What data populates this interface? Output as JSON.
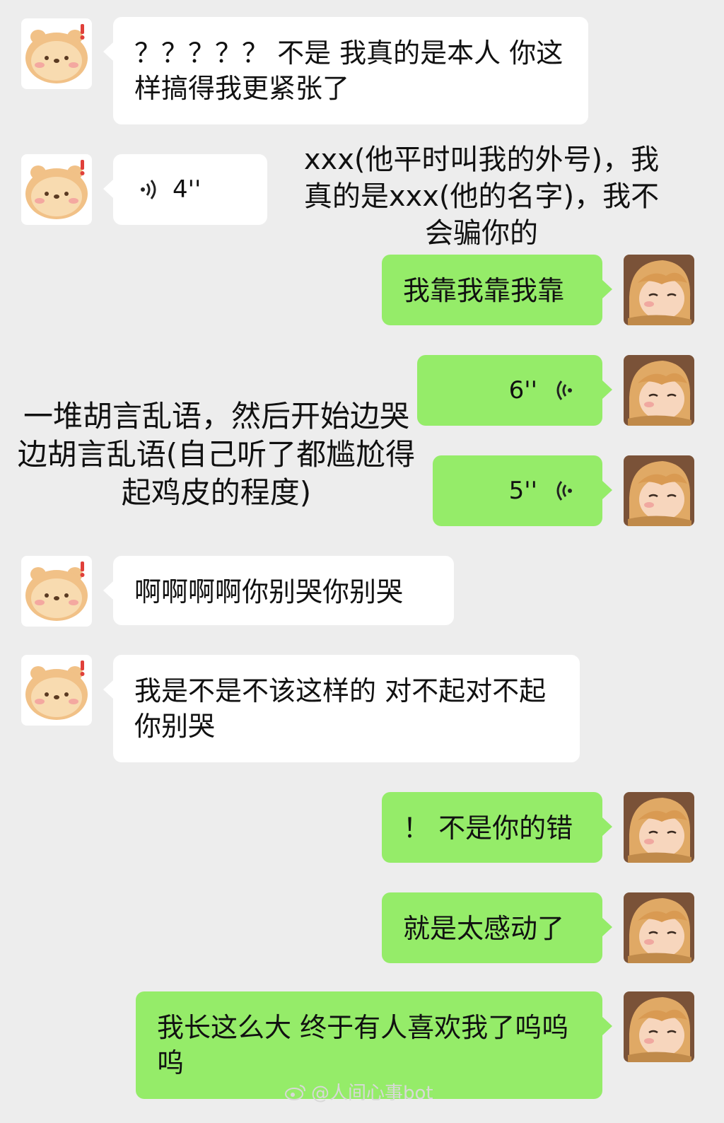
{
  "messages": [
    {
      "side": "in",
      "text": "？？？？？ 不是 我真的是本人 你这样搞得我更紧张了"
    },
    {
      "side": "in",
      "voice": "4''"
    },
    {
      "side": "out",
      "text": "我靠我靠我靠"
    },
    {
      "side": "out",
      "voice": "6''"
    },
    {
      "side": "out",
      "voice": "5''"
    },
    {
      "side": "in",
      "text": "啊啊啊啊你别哭你别哭"
    },
    {
      "side": "in",
      "text": "我是不是不该这样的 对不起对不起 你别哭"
    },
    {
      "side": "out",
      "text": "！ 不是你的错"
    },
    {
      "side": "out",
      "text": "就是太感动了"
    },
    {
      "side": "out",
      "text": "我长这么大 终于有人喜欢我了呜呜呜"
    }
  ],
  "annotations": {
    "voice_4": "xxx(他平时叫我的外号)，我真的是xxx(他的名字)，我不会骗你的",
    "voice_6_5": "一堆胡言乱语，然后开始边哭边胡言乱语(自己听了都尴尬得起鸡皮的程度)"
  },
  "watermark": "@人间心事bot",
  "icons": {
    "incoming_avatar": "bear-sticker-avatar",
    "outgoing_avatar": "anime-boy-avatar",
    "voice": "voice-wave-icon",
    "watermark": "weibo-logo-icon"
  },
  "colors": {
    "background": "#ededed",
    "incoming_bubble": "#ffffff",
    "outgoing_bubble": "#95ec69"
  }
}
